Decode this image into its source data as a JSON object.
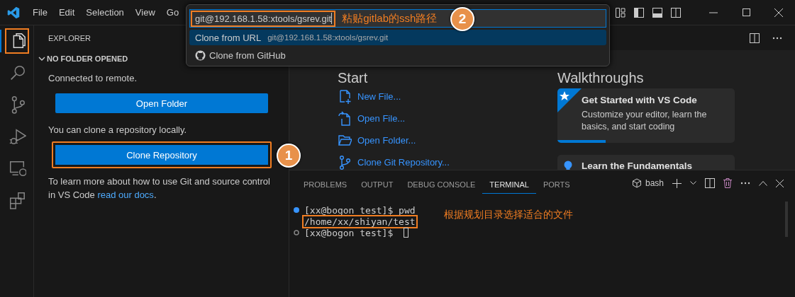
{
  "menu": [
    "File",
    "Edit",
    "Selection",
    "View",
    "Go"
  ],
  "quick_pick": {
    "value": "git@192.168.1.58:xtools/gsrev.git",
    "highlighted": true,
    "note": "粘贴gitlab的ssh路径",
    "step": "2",
    "items": [
      {
        "kind": "url",
        "label": "Clone from URL",
        "detail": "git@192.168.1.58:xtools/gsrev.git",
        "selected": true
      },
      {
        "kind": "github",
        "label": "Clone from GitHub",
        "selected": false
      }
    ]
  },
  "activity_bar": [
    {
      "kind": "explorer",
      "selected": true,
      "highlighted": true
    },
    {
      "kind": "search",
      "selected": false,
      "highlighted": false
    },
    {
      "kind": "source-control",
      "selected": false,
      "highlighted": false
    },
    {
      "kind": "run-debug",
      "selected": false,
      "highlighted": false
    },
    {
      "kind": "remote",
      "selected": false,
      "highlighted": false
    },
    {
      "kind": "extensions",
      "selected": false,
      "highlighted": false
    }
  ],
  "sidebar": {
    "title": "EXPLORER",
    "section": "NO FOLDER OPENED",
    "expanded": true,
    "remote_text": "Connected to remote.",
    "open_button": "Open Folder",
    "clone_text": "You can clone a repository locally.",
    "clone_button": {
      "label": "Clone Repository",
      "highlighted": true,
      "step": "1"
    },
    "docs_text": "To learn more about how to use Git and source control in VS Code ",
    "docs_link": "read our docs",
    "docs_end": "."
  },
  "start": {
    "title": "Start",
    "items": [
      {
        "kind": "new-file",
        "label": "New File..."
      },
      {
        "kind": "open-file",
        "label": "Open File..."
      },
      {
        "kind": "open-folder",
        "label": "Open Folder..."
      },
      {
        "kind": "clone",
        "label": "Clone Git Repository..."
      }
    ]
  },
  "walkthroughs": {
    "title": "Walkthroughs",
    "items": [
      {
        "kind": "featured",
        "title": "Get Started with VS Code",
        "description": "Customize your editor, learn the basics, and start coding",
        "level": 0.27
      },
      {
        "kind": "tip",
        "title": "Learn the Fundamentals"
      }
    ]
  },
  "panel": {
    "tabs": [
      {
        "label": "PROBLEMS",
        "selected": false
      },
      {
        "label": "OUTPUT",
        "selected": false
      },
      {
        "label": "DEBUG CONSOLE",
        "selected": false
      },
      {
        "label": "TERMINAL",
        "selected": true
      },
      {
        "label": "PORTS",
        "selected": false
      }
    ],
    "shell": "bash",
    "terminal": [
      {
        "kind": "command",
        "text": "[xx@bogon test]$ pwd",
        "highlighted": false
      },
      {
        "kind": "output",
        "text": "/home/xx/shiyan/test",
        "highlighted": true
      },
      {
        "kind": "prompt",
        "text": "[xx@bogon test]$ ",
        "cursor": true,
        "highlighted": false
      }
    ],
    "note": "根据规划目录选择适合的文件"
  }
}
